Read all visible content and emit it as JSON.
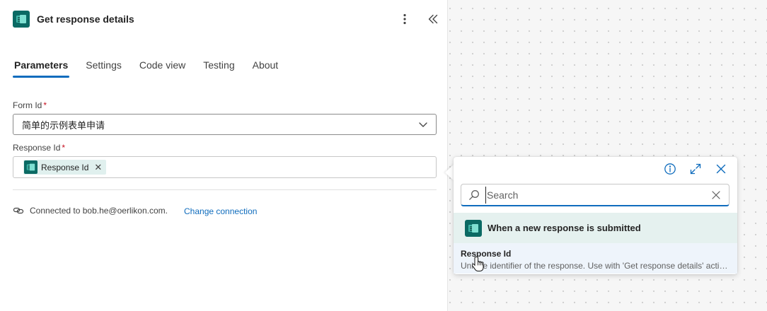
{
  "panel": {
    "title": "Get response details",
    "tabs": [
      {
        "label": "Parameters"
      },
      {
        "label": "Settings"
      },
      {
        "label": "Code view"
      },
      {
        "label": "Testing"
      },
      {
        "label": "About"
      }
    ],
    "active_tab": "Parameters"
  },
  "form": {
    "form_id": {
      "label": "Form Id",
      "required_mark": "*",
      "value": "简单的示例表单申请"
    },
    "response_id": {
      "label": "Response Id",
      "required_mark": "*",
      "token_label": "Response Id",
      "token_remove": "✕"
    }
  },
  "connection": {
    "text": "Connected to bob.he@oerlikon.com.",
    "change_label": "Change connection"
  },
  "popup": {
    "search_placeholder": "Search",
    "group_title": "When a new response is submitted",
    "item_title": "Response Id",
    "item_description": "Unique identifier of the response. Use with 'Get response details' action to retrieve the response details."
  },
  "icons": {
    "app": "forms-app-icon",
    "more": "more-vertical-icon",
    "collapse": "double-chevron-left-icon",
    "dropdown": "chevron-down-icon",
    "connection": "link-icon",
    "info": "info-icon",
    "expand": "expand-icon",
    "close": "close-icon",
    "search": "search-icon",
    "clear": "dismiss-icon"
  },
  "colors": {
    "accent": "#0f6cbd",
    "app_icon": "#0b6a64",
    "group_bg": "#e5f1ef",
    "item_hover_bg": "#eef4fb",
    "required": "#c50f1f"
  }
}
